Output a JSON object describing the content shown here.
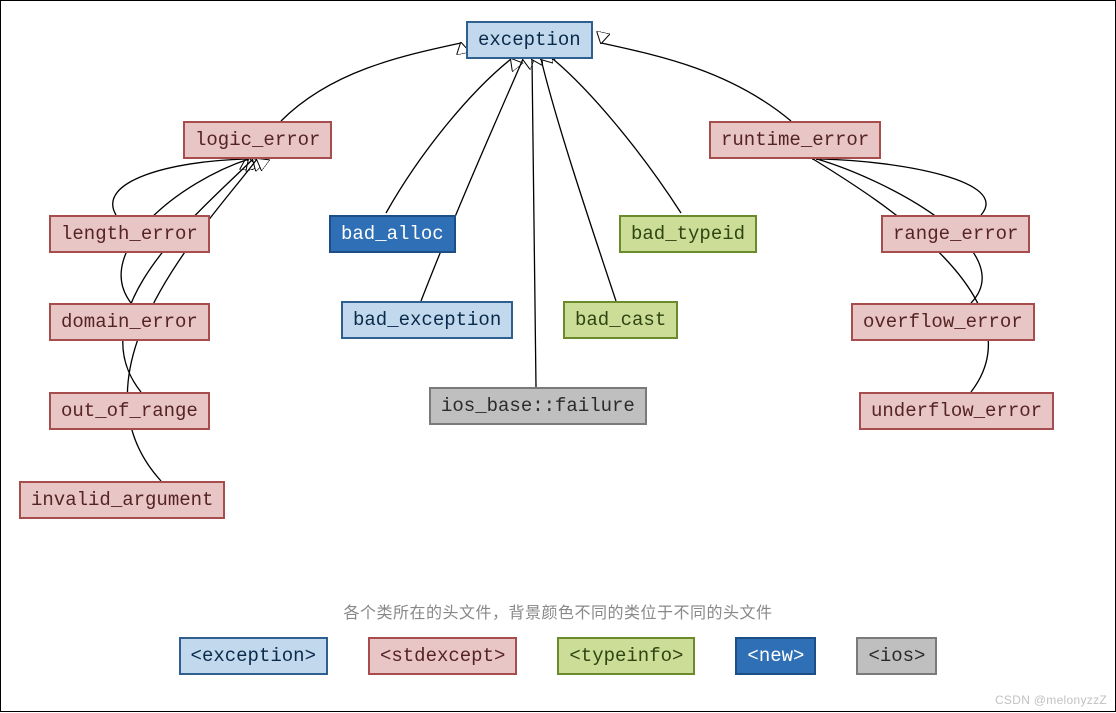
{
  "diagram": {
    "root": "exception",
    "logic_error_group": {
      "parent": "logic_error",
      "children": [
        "length_error",
        "domain_error",
        "out_of_range",
        "invalid_argument"
      ]
    },
    "runtime_error_group": {
      "parent": "runtime_error",
      "children": [
        "range_error",
        "overflow_error",
        "underflow_error"
      ]
    },
    "direct_children_of_exception": [
      "bad_alloc",
      "bad_exception",
      "bad_typeid",
      "bad_cast",
      "ios_base::failure"
    ]
  },
  "nodes": {
    "exception": {
      "label": "exception",
      "header": "exception"
    },
    "logic_error": {
      "label": "logic_error",
      "header": "stdexcept"
    },
    "runtime_error": {
      "label": "runtime_error",
      "header": "stdexcept"
    },
    "length_error": {
      "label": "length_error",
      "header": "stdexcept"
    },
    "domain_error": {
      "label": "domain_error",
      "header": "stdexcept"
    },
    "out_of_range": {
      "label": "out_of_range",
      "header": "stdexcept"
    },
    "invalid_argument": {
      "label": "invalid_argument",
      "header": "stdexcept"
    },
    "range_error": {
      "label": "range_error",
      "header": "stdexcept"
    },
    "overflow_error": {
      "label": "overflow_error",
      "header": "stdexcept"
    },
    "underflow_error": {
      "label": "underflow_error",
      "header": "stdexcept"
    },
    "bad_alloc": {
      "label": "bad_alloc",
      "header": "new"
    },
    "bad_exception": {
      "label": "bad_exception",
      "header": "exception"
    },
    "bad_typeid": {
      "label": "bad_typeid",
      "header": "typeinfo"
    },
    "bad_cast": {
      "label": "bad_cast",
      "header": "typeinfo"
    },
    "ios_base_failure": {
      "label": "ios_base::failure",
      "header": "ios"
    }
  },
  "legend": {
    "caption": "各个类所在的头文件，背景颜色不同的类位于不同的头文件",
    "items": [
      {
        "label": "<exception>",
        "header": "exception"
      },
      {
        "label": "<stdexcept>",
        "header": "stdexcept"
      },
      {
        "label": "<typeinfo>",
        "header": "typeinfo"
      },
      {
        "label": "<new>",
        "header": "new"
      },
      {
        "label": "<ios>",
        "header": "ios"
      }
    ]
  },
  "watermark": "CSDN @melonyzzZ",
  "colors": {
    "exception": "#c1d8ed",
    "stdexcept": "#e9c6c6",
    "typeinfo": "#cbdd96",
    "new": "#2f6fb5",
    "ios": "#bfbfbf"
  }
}
